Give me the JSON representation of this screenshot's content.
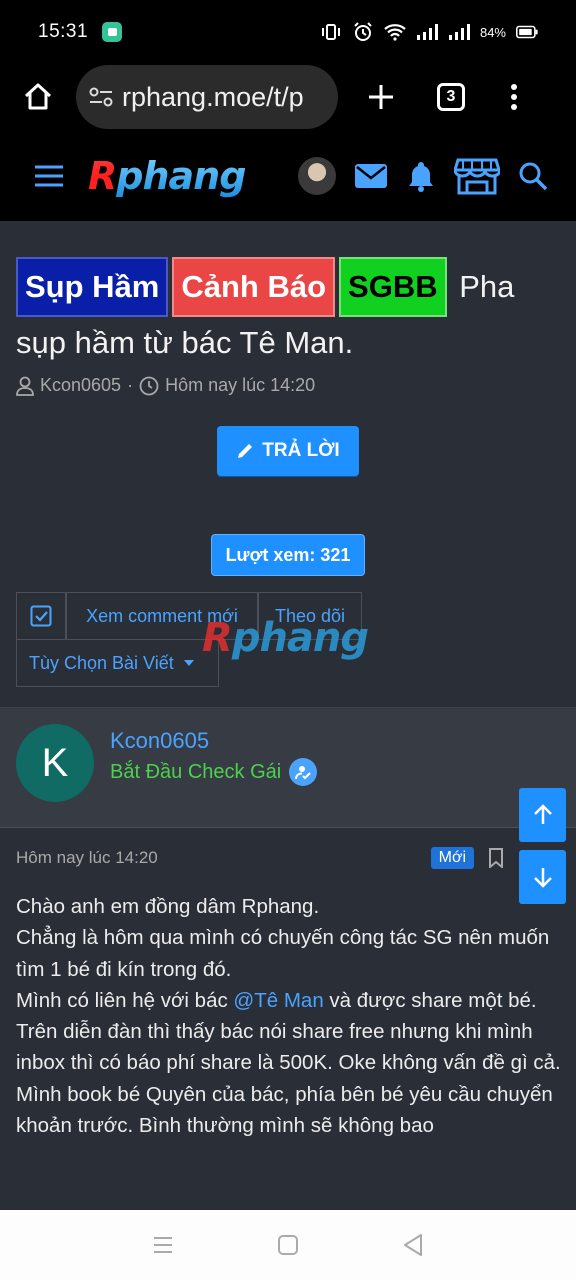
{
  "status_bar": {
    "time": "15:31",
    "battery": "84%"
  },
  "browser": {
    "url": "rphang.moe/t/p",
    "tab_count": "3"
  },
  "site": {
    "logo_first": "R",
    "logo_rest": "phang"
  },
  "thread": {
    "tags": [
      "Sụp Hầm",
      "Cảnh Báo",
      "SGBB"
    ],
    "title_line1": "Pha",
    "title_line2": "sụp hầm từ bác Tê Man.",
    "author": "Kcon0605",
    "date": "Hôm nay lúc 14:20",
    "reply_label": "TRẢ LỜI",
    "views_label": "Lượt xem: 321",
    "actions": [
      "Xem comment mới",
      "Theo dõi"
    ],
    "options_label": "Tùy Chọn Bài Viết"
  },
  "watermark": {
    "first": "R",
    "rest": "phang"
  },
  "post": {
    "user_initial": "K",
    "username": "Kcon0605",
    "user_title": "Bắt Đầu Check Gái",
    "date": "Hôm nay lúc 14:20",
    "new_badge": "Mới",
    "lines": [
      "Chào anh em đồng dâm Rphang.",
      "Chẳng là hôm qua mình có chuyến công tác SG nên muốn tìm 1 bé đi kín trong đó.",
      "Mình có liên hệ với bác ",
      "@Tê Man",
      " và được share một bé.",
      "Trên diễn đàn thì thấy bác nói share free nhưng khi mình inbox thì có báo phí share là 500K. Oke không vấn đề gì cả.",
      "Mình book bé Quyên của bác, phía bên bé yêu cầu chuyển khoản trước. Bình thường mình sẽ không bao"
    ]
  },
  "colors": {
    "accent": "#1e90ff",
    "bg": "#2a2e36",
    "user_title": "#4cd14c"
  }
}
